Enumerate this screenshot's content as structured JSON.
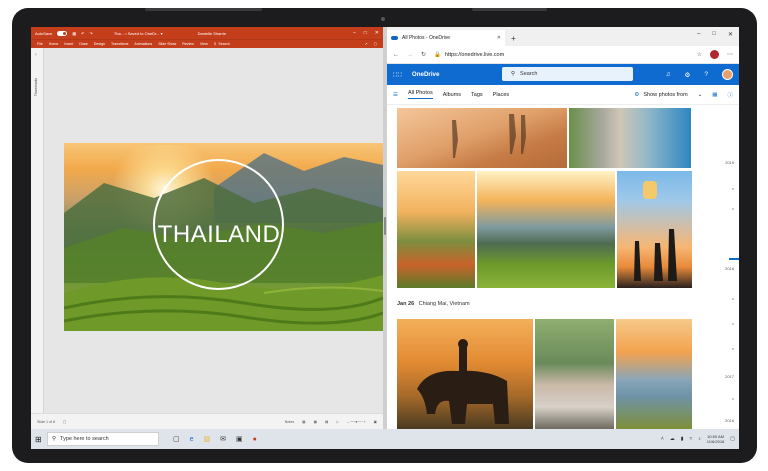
{
  "powerpoint": {
    "autosave_label": "AutoSave",
    "title": "Tha... • Saved to OneDr... ▾",
    "user": "Danielle Sharrie",
    "menu": [
      "File",
      "Home",
      "Insert",
      "Draw",
      "Design",
      "Transitions",
      "Animations",
      "Slide Show",
      "Review",
      "View"
    ],
    "search_label": "Search",
    "thumbnails_label": "Thumbnails",
    "slide_title": "THAILAND",
    "status_slide": "Slide 1 of 8",
    "notes_label": "Notes"
  },
  "browser": {
    "tab_title": "All Photos - OneDrive",
    "url": "https://onedrive.live.com",
    "onedrive_brand": "OneDrive",
    "search_placeholder": "Search",
    "nav": [
      "All Photos",
      "Albums",
      "Tags",
      "Places"
    ],
    "show_photos_from": "Show photos from",
    "group_date": "Jan 26",
    "group_place": "Chiang Mai, Vietnam",
    "timeline_years": [
      "2019",
      "2018",
      "2017",
      "2016"
    ]
  },
  "taskbar": {
    "search_placeholder": "Type here to search",
    "time": "10:50 AM",
    "date": "11/6/2018"
  }
}
